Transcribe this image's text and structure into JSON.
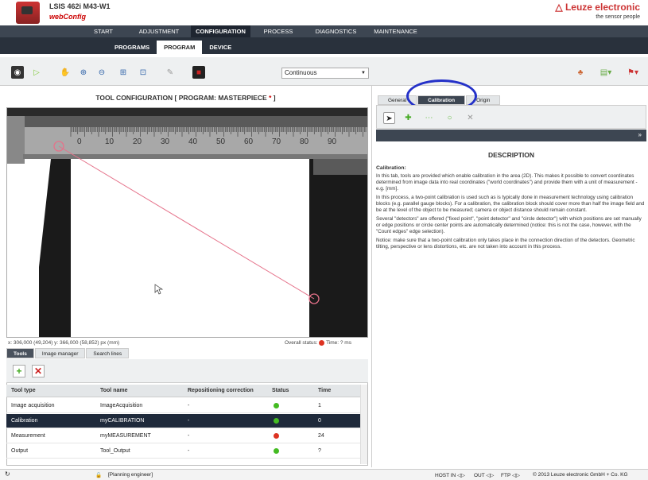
{
  "header": {
    "device": "LSIS 462i M43-W1",
    "app": "webConfig",
    "brand": "△ Leuze electronic",
    "tagline": "the sensor people"
  },
  "main_nav": [
    {
      "label": "START"
    },
    {
      "label": "ADJUSTMENT"
    },
    {
      "label": "CONFIGURATION",
      "active": true
    },
    {
      "label": "PROCESS"
    },
    {
      "label": "DIAGNOSTICS"
    },
    {
      "label": "MAINTENANCE"
    }
  ],
  "sub_nav": [
    {
      "label": "PROGRAMS"
    },
    {
      "label": "PROGRAM",
      "active": true
    },
    {
      "label": "DEVICE"
    }
  ],
  "toolbar": {
    "mode": "Continuous"
  },
  "left_panel": {
    "title": "TOOL CONFIGURATION   [ PROGRAM: MASTERPIECE ",
    "title_star": "*",
    "title_end": " ]",
    "ruler_numbers": [
      "0",
      "10",
      "20",
      "30",
      "40",
      "50",
      "60",
      "70",
      "80",
      "90"
    ],
    "coords": "x: 306,000 (49,204) y: 366,000 (58,852) px (mm)",
    "overall_status_label": "Overall status:",
    "time_label": "Time: ? ms",
    "bottom_tabs": [
      {
        "label": "Tools",
        "active": true
      },
      {
        "label": "Image manager"
      },
      {
        "label": "Search lines"
      }
    ],
    "table": {
      "headers": [
        "Tool type",
        "Tool name",
        "Repositioning correction",
        "Status",
        "Time"
      ],
      "rows": [
        {
          "type": "Image acquisition",
          "name": "ImageAcquisition",
          "repos": "-",
          "status": "green",
          "time": "1"
        },
        {
          "type": "Calibration",
          "name": "myCALIBRATION",
          "repos": "-",
          "status": "green",
          "time": "0",
          "selected": true
        },
        {
          "type": "Measurement",
          "name": "myMEASUREMENT",
          "repos": "-",
          "status": "red",
          "time": "24"
        },
        {
          "type": "Output",
          "name": "Tool_Output",
          "repos": "-",
          "status": "green",
          "time": "?"
        }
      ]
    }
  },
  "right_panel": {
    "tabs": [
      {
        "label": "General"
      },
      {
        "label": "Calibration",
        "active": true
      },
      {
        "label": "Origin"
      }
    ],
    "desc_title": "DESCRIPTION",
    "desc_heading": "Calibration:",
    "desc_paragraphs": [
      "In this tab, tools are provided which enable calibration in the area (2D). This makes it possible to convert coordinates determined from image data into real coordinates (\"world coordinates\") and provide them with a unit of measurement - e.g. [mm].",
      "In this process, a two-point calibration is used such as is typically done in measurement technology using calibration blocks (e.g. parallel gauge blocks). For a calibration, the calibration block should cover more than half the image field and be at the level of the object to be measured; camera or object distance should remain constant.",
      "Several \"detectors\" are offered (\"fixed point\", \"point detector\" and \"circle detector\") with which positions are set manually or edge positions or circle center points are automatically determined (notice: this is not the case, however, with the \"Count edges\" edge selection).",
      "Notice: make sure that a two-point calibration only takes place in the connection direction of the detectors. Geometric tilting, perspective or lens distortions, etc. are not taken into account in this process."
    ]
  },
  "status_bar": {
    "role": "[Planning engineer]",
    "host": "HOST IN",
    "out": "OUT",
    "ftp": "FTP",
    "copyright": "© 2013 Leuze electronic GmbH + Co. KG"
  },
  "colors": {
    "brand": "#cc3333",
    "nav_dark": "#29313c",
    "selection": "#1f2a3b",
    "ok": "#44bb22",
    "error": "#dd3322",
    "highlight_circle": "#2431c8"
  }
}
